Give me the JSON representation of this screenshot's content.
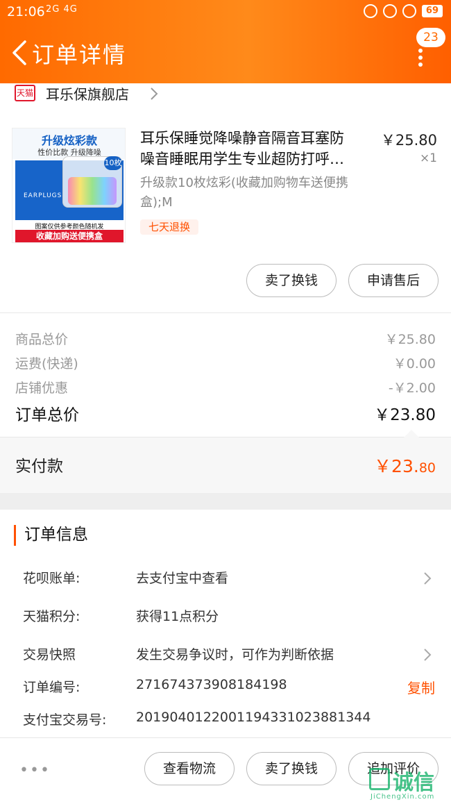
{
  "status_bar": {
    "time": "21:06",
    "signals": "2G 4G",
    "battery": "69"
  },
  "header": {
    "title": "订单详情",
    "message_count": "23"
  },
  "store": {
    "name": "耳乐保旗舰店",
    "badge": "天猫"
  },
  "product": {
    "image_text": {
      "headline": "升级炫彩款",
      "subline": "性价比款 升级降噪",
      "count_badge": "10枚",
      "brand": "EARPLUGS",
      "note": "图案仅供参考颜色随机发",
      "banner": "收藏加购送便携盒"
    },
    "title_line1": "耳乐保睡觉降噪静音隔音耳塞防",
    "title_line2": "噪音睡眠用学生专业超防打呼…",
    "price": "￥25.80",
    "quantity": "×1",
    "sku": "升级款10枚炫彩(收藏加购物车送便携盒);M",
    "return_tag": "七天退换",
    "buttons": {
      "sell": "卖了换钱",
      "aftersale": "申请售后"
    }
  },
  "summary": {
    "goods_total_label": "商品总价",
    "goods_total": "￥25.80",
    "shipping_label": "运费(快递)",
    "shipping": "￥0.00",
    "discount_label": "店铺优惠",
    "discount": "-￥2.00",
    "order_total_label": "订单总价",
    "order_total": "￥23.80",
    "paid_label": "实付款",
    "paid_main": "￥23.",
    "paid_cents": "80"
  },
  "order_info": {
    "title": "订单信息",
    "rows": [
      {
        "key": "花呗账单:",
        "value": "去支付宝中查看"
      },
      {
        "key": "天猫积分:",
        "value": "获得11点积分"
      },
      {
        "key": "交易快照",
        "value": "发生交易争议时，可作为判断依据"
      },
      {
        "key": "订单编号:",
        "value": "271674373908184198",
        "action": "复制"
      },
      {
        "key": "支付宝交易号:",
        "value": "2019040122001194331023881344"
      }
    ]
  },
  "bottom_bar": {
    "more": "•••",
    "logistics": "查看物流",
    "sell": "卖了换钱",
    "review": "追加评价"
  },
  "watermark": {
    "text": "诚信",
    "site": "JiChengXin.com"
  },
  "colors": {
    "accent": "#ff5000",
    "header_gradient_start": "#ff6a00",
    "header_gradient_end": "#ff5f00"
  }
}
